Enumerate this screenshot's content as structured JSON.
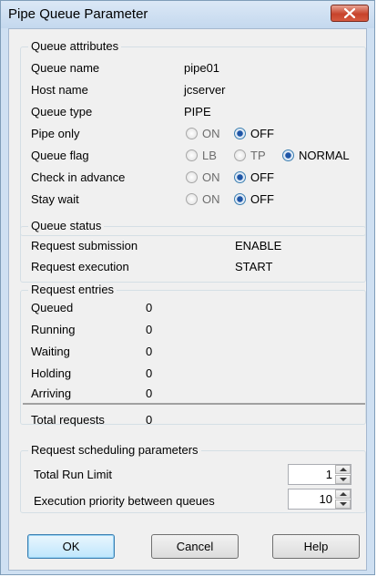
{
  "window": {
    "title": "Pipe Queue Parameter"
  },
  "queue_attributes": {
    "group_label": "Queue attributes",
    "queue_name_label": "Queue name",
    "queue_name_value": "pipe01",
    "host_name_label": "Host name",
    "host_name_value": "jcserver",
    "queue_type_label": "Queue type",
    "queue_type_value": "PIPE",
    "pipe_only_label": "Pipe only",
    "pipe_only_on": "ON",
    "pipe_only_off": "OFF",
    "queue_flag_label": "Queue flag",
    "queue_flag_lb": "LB",
    "queue_flag_tp": "TP",
    "queue_flag_normal": "NORMAL",
    "check_advance_label": "Check in advance",
    "check_advance_on": "ON",
    "check_advance_off": "OFF",
    "stay_wait_label": "Stay wait",
    "stay_wait_on": "ON",
    "stay_wait_off": "OFF"
  },
  "queue_status": {
    "group_label": "Queue status",
    "submission_label": "Request submission",
    "submission_value": "ENABLE",
    "execution_label": "Request execution",
    "execution_value": "START"
  },
  "request_entries": {
    "group_label": "Request entries",
    "rows": [
      {
        "label": "Queued",
        "value": "0"
      },
      {
        "label": "Running",
        "value": "0"
      },
      {
        "label": "Waiting",
        "value": "0"
      },
      {
        "label": "Holding",
        "value": "0"
      },
      {
        "label": "Arriving",
        "value": "0"
      }
    ],
    "total_label": "Total requests",
    "total_value": "0"
  },
  "scheduling": {
    "group_label": "Request scheduling parameters",
    "total_run_limit_label": "Total Run Limit",
    "total_run_limit_value": "1",
    "exec_priority_label": "Execution priority between queues",
    "exec_priority_value": "10"
  },
  "buttons": {
    "ok": "OK",
    "cancel": "Cancel",
    "help": "Help"
  }
}
